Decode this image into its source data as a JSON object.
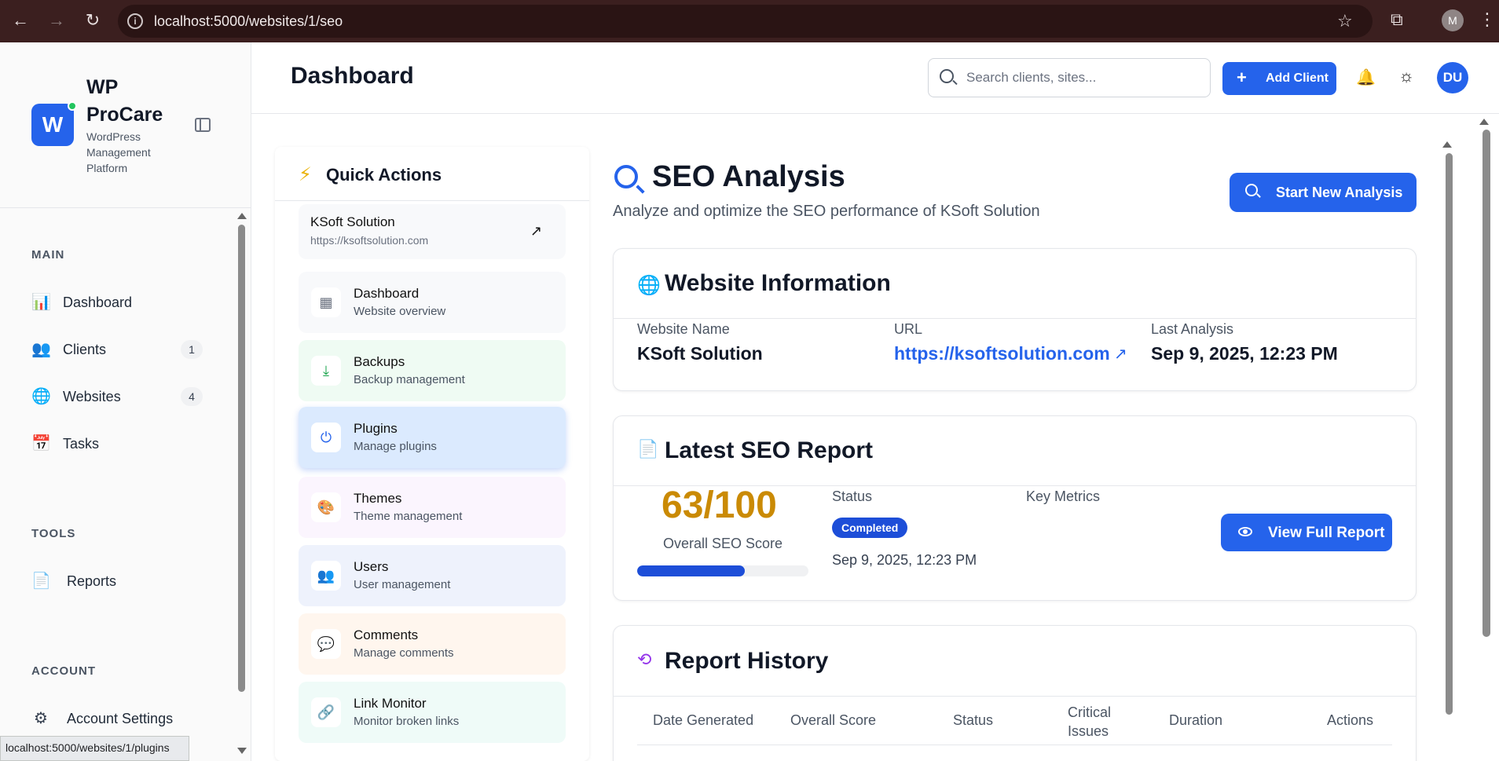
{
  "browser": {
    "url": "localhost:5000/websites/1/seo",
    "profile_initial": "M",
    "status_url": "localhost:5000/websites/1/plugins"
  },
  "sidebar": {
    "brand_name": "WP ProCare",
    "brand_sub": "WordPress Management Platform",
    "logo_letter": "W",
    "sections": {
      "main": "MAIN",
      "tools": "TOOLS",
      "account": "ACCOUNT"
    },
    "main_items": [
      {
        "label": "Dashboard",
        "icon": "bar-chart-icon"
      },
      {
        "label": "Clients",
        "icon": "users-icon",
        "count": "1"
      },
      {
        "label": "Websites",
        "icon": "globe-icon",
        "count": "4"
      },
      {
        "label": "Tasks",
        "icon": "calendar-icon"
      }
    ],
    "tools_items": [
      {
        "label": "Reports",
        "icon": "document-icon"
      }
    ],
    "account_items": [
      {
        "label": "Account Settings",
        "icon": "gear-icon"
      }
    ]
  },
  "header": {
    "title": "Dashboard",
    "search_placeholder": "Search clients, sites...",
    "add_client_label": "Add Client",
    "user_initials": "DU"
  },
  "quick_actions": {
    "title": "Quick Actions",
    "site": {
      "name": "KSoft Solution",
      "url": "https://ksoftsolution.com"
    },
    "items": [
      {
        "name": "Dashboard",
        "desc": "Website overview",
        "icon": "grid-icon",
        "bg": "#f8f9fb",
        "color": "#6b7280"
      },
      {
        "name": "Backups",
        "desc": "Backup management",
        "icon": "download-icon",
        "bg": "#effbf3",
        "color": "#16a34a"
      },
      {
        "name": "Plugins",
        "desc": "Manage plugins",
        "icon": "plug-icon",
        "bg": "#dbeafe",
        "color": "#2563eb"
      },
      {
        "name": "Themes",
        "desc": "Theme management",
        "icon": "palette-icon",
        "bg": "#fbf5fe",
        "color": "#9333ea"
      },
      {
        "name": "Users",
        "desc": "User management",
        "icon": "users-icon",
        "bg": "#eef2fc",
        "color": "#4f46e5"
      },
      {
        "name": "Comments",
        "desc": "Manage comments",
        "icon": "comment-icon",
        "bg": "#fff6ee",
        "color": "#ea580c"
      },
      {
        "name": "Link Monitor",
        "desc": "Monitor broken links",
        "icon": "link-icon",
        "bg": "#effbf8",
        "color": "#0d9488"
      }
    ]
  },
  "seo": {
    "title": "SEO Analysis",
    "subtitle": "Analyze and optimize the SEO performance of KSoft Solution",
    "start_button": "Start New Analysis",
    "website_info": {
      "title": "Website Information",
      "name_label": "Website Name",
      "name_value": "KSoft Solution",
      "url_label": "URL",
      "url_value": "https://ksoftsolution.com",
      "last_label": "Last Analysis",
      "last_value": "Sep 9, 2025, 12:23 PM"
    },
    "latest_report": {
      "title": "Latest SEO Report",
      "score": "63/100",
      "score_percent": 63,
      "score_label": "Overall SEO Score",
      "status_label": "Status",
      "status_value": "Completed",
      "date": "Sep 9, 2025, 12:23 PM",
      "metrics_label": "Key Metrics",
      "view_button": "View Full Report"
    },
    "history": {
      "title": "Report History",
      "columns": [
        "Date Generated",
        "Overall Score",
        "Status",
        "Critical Issues",
        "Duration",
        "Actions"
      ]
    }
  },
  "colors": {
    "accent": "#2563eb",
    "score": "#ca8a04",
    "online": "#22c55e"
  }
}
